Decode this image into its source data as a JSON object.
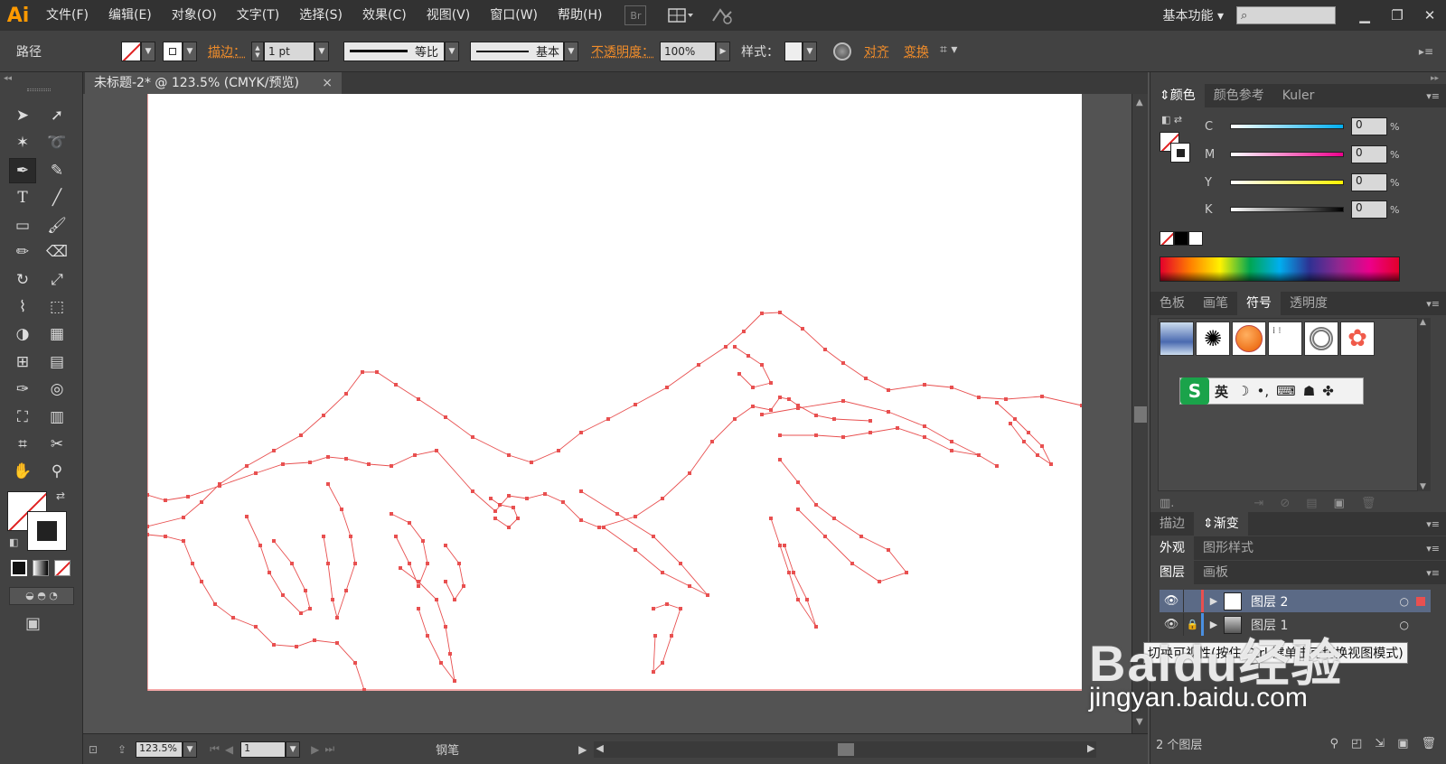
{
  "app": {
    "logo": "Ai",
    "workspace": "基本功能"
  },
  "menu": [
    "文件(F)",
    "编辑(E)",
    "对象(O)",
    "文字(T)",
    "选择(S)",
    "效果(C)",
    "视图(V)",
    "窗口(W)",
    "帮助(H)"
  ],
  "menu_badge": "Br",
  "control": {
    "object_type": "路径",
    "stroke_label": "描边",
    "stroke_weight": "1 pt",
    "profile_label": "等比",
    "brush_label": "基本",
    "opacity_label": "不透明度",
    "opacity_value": "100%",
    "style_label": "样式",
    "align_label": "对齐",
    "transform_label": "变换"
  },
  "document": {
    "tab_title": "未标题-2* @ 123.5% (CMYK/预览)",
    "close": "×"
  },
  "status": {
    "zoom": "123.5%",
    "artboard": "1",
    "tool": "钢笔"
  },
  "color_panel": {
    "tabs": [
      "颜色",
      "颜色参考",
      "Kuler"
    ],
    "sliders": [
      {
        "label": "C",
        "value": "0",
        "color": "#00aeef"
      },
      {
        "label": "M",
        "value": "0",
        "color": "#ec008c"
      },
      {
        "label": "Y",
        "value": "0",
        "color": "#fff200"
      },
      {
        "label": "K",
        "value": "0",
        "color": "#000000"
      }
    ],
    "pct": "%"
  },
  "swatch_panel": {
    "tabs": [
      "色板",
      "画笔",
      "符号",
      "透明度"
    ]
  },
  "ime_bar": {
    "label": "英"
  },
  "stroke_panel": {
    "tabs": [
      "描边",
      "渐变"
    ]
  },
  "appearance_panel": {
    "tabs": [
      "外观",
      "图形样式"
    ]
  },
  "layers_panel": {
    "tabs": [
      "图层",
      "画板"
    ],
    "layers": [
      {
        "name": "图层 2"
      },
      {
        "name": "图层 1"
      }
    ],
    "count": "2 个图层"
  },
  "tooltip": "切换可视性(按住 Ctrl 键单击可切换视图模式)",
  "watermark": {
    "main": "Baidu经验",
    "url": "jingyan.baidu.com"
  },
  "colors": {
    "accent_orange": "#f08c2a",
    "path_red": "#e85050",
    "layer_blue": "#4a8fe0"
  }
}
